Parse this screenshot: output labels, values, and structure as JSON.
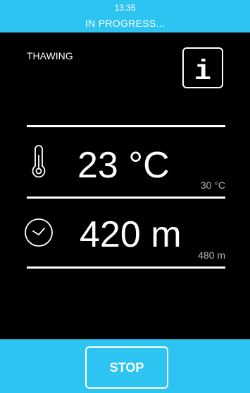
{
  "status": {
    "time": "13:35",
    "text": "IN PROGRESS..."
  },
  "mode": {
    "label": "THAWING"
  },
  "info_button": {
    "icon": "info-icon",
    "glyph": "i"
  },
  "temperature": {
    "icon": "thermometer-icon",
    "current": "23 °C",
    "set": "30 °C"
  },
  "time": {
    "icon": "clock-icon",
    "current": "420 m",
    "set": "480 m"
  },
  "actions": {
    "stop_label": "STOP"
  },
  "colors": {
    "accent": "#2ec4f1",
    "background": "#000000",
    "foreground": "#ffffff",
    "secondary_text": "#b5b5b5"
  }
}
